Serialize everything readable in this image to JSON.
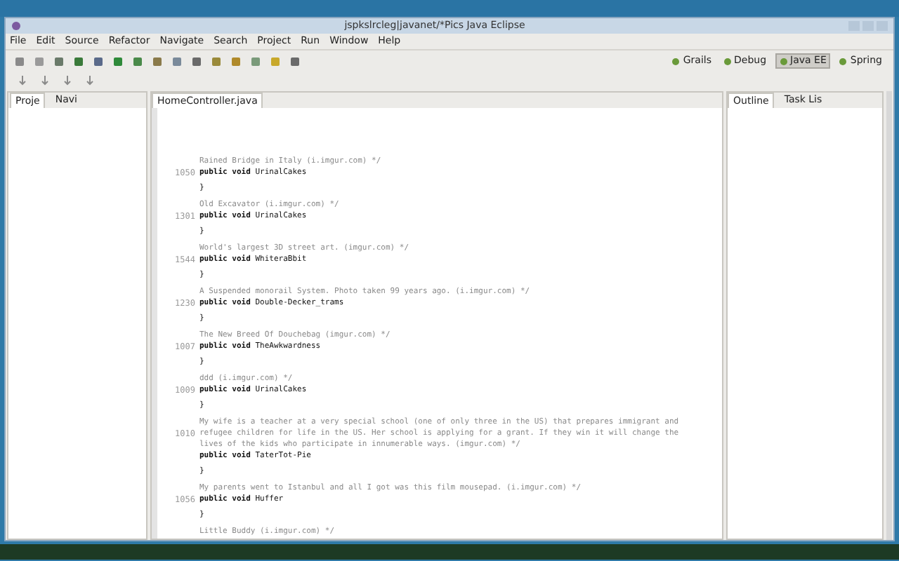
{
  "window": {
    "title": "jspkslrcleg|javanet/*Pics Java Eclipse"
  },
  "menu": [
    "File",
    "Edit",
    "Source",
    "Refactor",
    "Navigate",
    "Search",
    "Project",
    "Run",
    "Window",
    "Help"
  ],
  "perspectives": [
    {
      "label": "Grails",
      "selected": false
    },
    {
      "label": "Debug",
      "selected": false
    },
    {
      "label": "Java EE",
      "selected": true
    },
    {
      "label": "Spring",
      "selected": false
    }
  ],
  "left_tabs": [
    {
      "label": "Proje",
      "selected": true
    },
    {
      "label": "Navi",
      "selected": false
    }
  ],
  "editor_tabs": [
    {
      "label": "HomeController.java",
      "selected": true
    }
  ],
  "right_tabs": [
    {
      "label": "Outline",
      "selected": true
    },
    {
      "label": "Task Lis",
      "selected": false
    }
  ],
  "code_lines": [
    {
      "kind": "comment",
      "text": "Rained Bridge in Italy (i.imgur.com) */"
    },
    {
      "kind": "method",
      "number": "1050",
      "text": "**public void** UrinalCakes"
    },
    {
      "kind": "brace",
      "text": "}"
    },
    {
      "kind": "comment",
      "text": "Old Excavator (i.imgur.com) */"
    },
    {
      "kind": "method",
      "number": "1301",
      "text": "**public void** UrinalCakes"
    },
    {
      "kind": "brace",
      "text": "}"
    },
    {
      "kind": "comment",
      "text": "World's largest 3D street art. (imgur.com) */"
    },
    {
      "kind": "method",
      "number": "1544",
      "text": "**public void** WhiteraBbit"
    },
    {
      "kind": "brace",
      "text": "}"
    },
    {
      "kind": "comment",
      "text": "A Suspended monorail System. Photo taken 99 years ago. (i.imgur.com) */"
    },
    {
      "kind": "method",
      "number": "1230",
      "text": "**public void** Double-Decker_trams"
    },
    {
      "kind": "brace",
      "text": "}"
    },
    {
      "kind": "comment",
      "text": "The New Breed Of Douchebag (imgur.com) */"
    },
    {
      "kind": "method",
      "number": "1007",
      "text": "**public void** TheAwkwardness"
    },
    {
      "kind": "brace",
      "text": "}"
    },
    {
      "kind": "comment",
      "text": "ddd (i.imgur.com) */"
    },
    {
      "kind": "method",
      "number": "1009",
      "text": "**public void** UrinalCakes"
    },
    {
      "kind": "brace",
      "text": "}"
    },
    {
      "kind": "comment",
      "text": "My wife is a teacher at a very special school (one of only three in the US) that prepares immigrant and"
    },
    {
      "kind": "comment",
      "number": "1010",
      "text": "refugee children for life in the US. Her school is applying for a grant. If they win it will change the"
    },
    {
      "kind": "comment",
      "text": "lives of the kids who participate in innumerable ways. (imgur.com) */"
    },
    {
      "kind": "method",
      "text": "**public void** TaterTot-Pie"
    },
    {
      "kind": "brace",
      "text": "}"
    },
    {
      "kind": "comment",
      "text": "My parents went to Istanbul and all I got was this film mousepad. (i.imgur.com) */"
    },
    {
      "kind": "method",
      "number": "1056",
      "text": "**public void** Huffer"
    },
    {
      "kind": "brace",
      "text": "}"
    },
    {
      "kind": "comment",
      "text": "Little Buddy (i.imgur.com) */"
    }
  ]
}
